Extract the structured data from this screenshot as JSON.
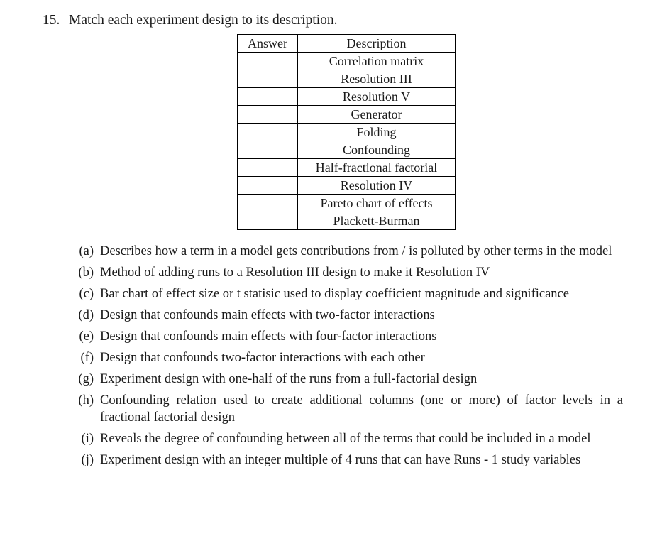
{
  "question": {
    "number": "15.",
    "prompt": "Match each experiment design to its description."
  },
  "table": {
    "headers": {
      "answer": "Answer",
      "description": "Description"
    },
    "rows": [
      {
        "answer": "",
        "description": "Correlation matrix"
      },
      {
        "answer": "",
        "description": "Resolution III"
      },
      {
        "answer": "",
        "description": "Resolution V"
      },
      {
        "answer": "",
        "description": "Generator"
      },
      {
        "answer": "",
        "description": "Folding"
      },
      {
        "answer": "",
        "description": "Confounding"
      },
      {
        "answer": "",
        "description": "Half-fractional factorial"
      },
      {
        "answer": "",
        "description": "Resolution IV"
      },
      {
        "answer": "",
        "description": "Pareto chart of effects"
      },
      {
        "answer": "",
        "description": "Plackett-Burman"
      }
    ]
  },
  "options": [
    {
      "label": "(a)",
      "text": "Describes how a term in a model gets contributions from / is polluted by other terms in the model",
      "justify": true
    },
    {
      "label": "(b)",
      "text": "Method of adding runs to a Resolution III design to make it Resolution IV",
      "justify": false
    },
    {
      "label": "(c)",
      "text": "Bar chart of effect size or t statisic used to display coefficient magnitude and signifi­cance",
      "justify": true
    },
    {
      "label": "(d)",
      "text": "Design that confounds main effects with two-factor interactions",
      "justify": false
    },
    {
      "label": "(e)",
      "text": "Design that confounds main effects with four-factor interactions",
      "justify": false
    },
    {
      "label": "(f)",
      "text": "Design that confounds two-factor interactions with each other",
      "justify": false
    },
    {
      "label": "(g)",
      "text": "Experiment design with one-half of the runs from a full-factorial design",
      "justify": false
    },
    {
      "label": "(h)",
      "text": "Confounding relation used to create additional columns (one or more) of factor levels in a fractional factorial design",
      "justify": true
    },
    {
      "label": "(i)",
      "text": "Reveals the degree of confounding between all of the terms that could be included in a model",
      "justify": true
    },
    {
      "label": "(j)",
      "text": "Experiment design with an integer multiple of 4 runs that can have Runs - 1 study variables",
      "justify": true
    }
  ]
}
